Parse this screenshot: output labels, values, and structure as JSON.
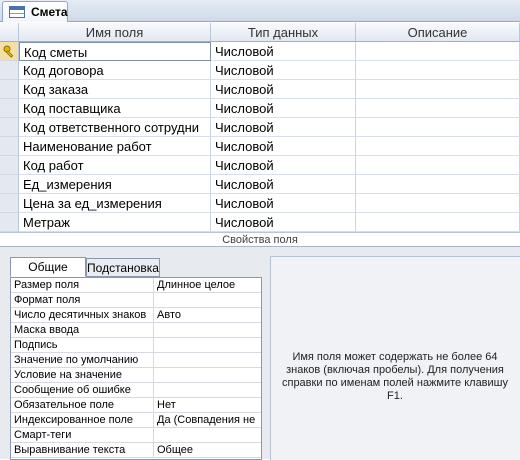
{
  "tab": {
    "title": "Смета",
    "icon": "table-icon"
  },
  "grid": {
    "columns": [
      "Имя поля",
      "Тип данных",
      "Описание"
    ],
    "rows": [
      {
        "name": "Код сметы",
        "type": "Числовой",
        "description": ""
      },
      {
        "name": "Код договора",
        "type": "Числовой",
        "description": ""
      },
      {
        "name": "Код заказа",
        "type": "Числовой",
        "description": ""
      },
      {
        "name": "Код поставщика",
        "type": "Числовой",
        "description": ""
      },
      {
        "name": "Код ответственного сотрудни",
        "type": "Числовой",
        "description": ""
      },
      {
        "name": "Наименование работ",
        "type": "Числовой",
        "description": ""
      },
      {
        "name": "Код работ",
        "type": "Числовой",
        "description": ""
      },
      {
        "name": "Ед_измерения",
        "type": "Числовой",
        "description": ""
      },
      {
        "name": "Цена за ед_измерения",
        "type": "Числовой",
        "description": ""
      },
      {
        "name": "Метраж",
        "type": "Числовой",
        "description": ""
      }
    ],
    "primary_key_icon": "key-icon"
  },
  "properties": {
    "caption": "Свойства поля",
    "tabs": [
      "Общие",
      "Подстановка"
    ],
    "rows": [
      {
        "name": "Размер поля",
        "value": "Длинное целое"
      },
      {
        "name": "Формат поля",
        "value": ""
      },
      {
        "name": "Число десятичных знаков",
        "value": "Авто"
      },
      {
        "name": "Маска ввода",
        "value": ""
      },
      {
        "name": "Подпись",
        "value": ""
      },
      {
        "name": "Значение по умолчанию",
        "value": ""
      },
      {
        "name": "Условие на значение",
        "value": ""
      },
      {
        "name": "Сообщение об ошибке",
        "value": ""
      },
      {
        "name": "Обязательное поле",
        "value": "Нет"
      },
      {
        "name": "Индексированное поле",
        "value": "Да (Совпадения не"
      },
      {
        "name": "Смарт-теги",
        "value": ""
      },
      {
        "name": "Выравнивание текста",
        "value": "Общее"
      }
    ],
    "help": "Имя поля может содержать не более 64 знаков (включая пробелы). Для получения справки по именам полей нажмите клавишу F1."
  }
}
